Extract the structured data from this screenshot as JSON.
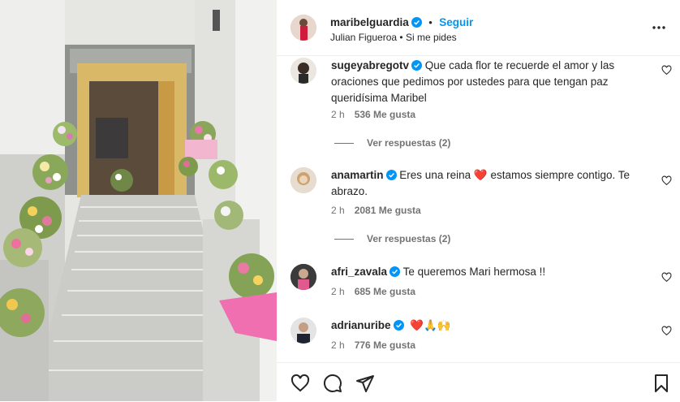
{
  "post": {
    "author": "maribelguardia",
    "dot": "•",
    "follow_label": "Seguir",
    "audio_artist": "Julian Figueroa",
    "audio_sep": "•",
    "audio_song": "Si me pides",
    "more_icon": "more-horizontal-icon"
  },
  "comments": [
    {
      "user": "sugeyabregotv",
      "verified": true,
      "text": "Que cada flor te recuerde el amor y las oraciones que pedimos por ustedes para que tengan paz queridísima Maribel",
      "time": "2 h",
      "likes": "536 Me gusta",
      "replies": "Ver respuestas (2)"
    },
    {
      "user": "anamartin",
      "verified": true,
      "text_before": "Eres una reina",
      "emoji": "❤️",
      "text_after": "estamos siempre contigo. Te abrazo.",
      "time": "2 h",
      "likes": "2081 Me gusta",
      "replies": "Ver respuestas (2)"
    },
    {
      "user": "afri_zavala",
      "verified": true,
      "text": "Te queremos Mari hermosa !!",
      "time": "2 h",
      "likes": "685 Me gusta"
    },
    {
      "user": "adrianuribe",
      "verified": true,
      "emojis": "❤️🙏🙌",
      "time": "2 h",
      "likes": "776 Me gusta"
    }
  ],
  "colors": {
    "accent": "#0095f6",
    "verified": "#0095f6",
    "heart": "#ed4956",
    "muted": "#737373"
  },
  "actions": [
    "heart-icon",
    "comment-icon",
    "share-icon",
    "bookmark-icon"
  ]
}
